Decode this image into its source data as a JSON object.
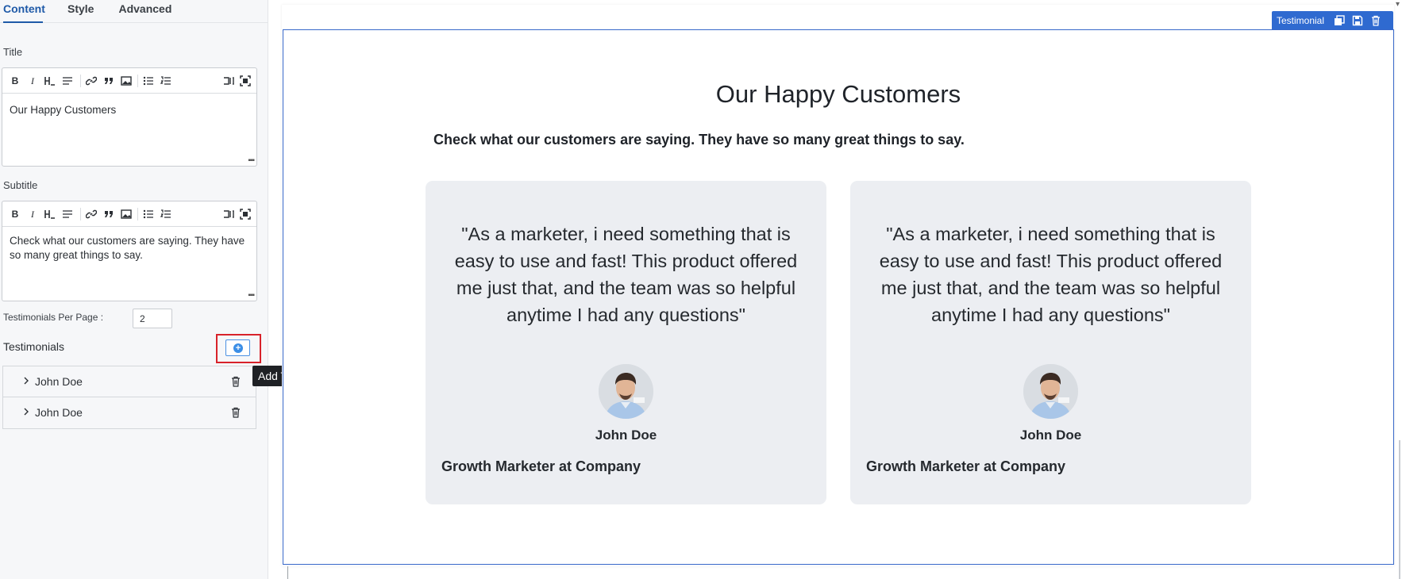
{
  "tabs": [
    {
      "label": "Content",
      "active": true
    },
    {
      "label": "Style",
      "active": false
    },
    {
      "label": "Advanced",
      "active": false
    }
  ],
  "title_field": {
    "label": "Title",
    "value": "Our Happy Customers"
  },
  "subtitle_field": {
    "label": "Subtitle",
    "value": "Check what our customers are saying. They have so many great things to say."
  },
  "editor_toolbar_icons": [
    "bold-icon",
    "italic-icon",
    "heading-icon",
    "strikethrough-icon",
    "link-icon",
    "quote-icon",
    "image-icon",
    "bullet-list-icon",
    "numbered-list-icon",
    "side-by-side-icon",
    "fullscreen-icon"
  ],
  "editor_toolbar_glyphs": {
    "bold": "B",
    "italic": "I"
  },
  "per_page": {
    "label": "Testimonials Per Page :",
    "value": "2"
  },
  "testimonials_section": {
    "label": "Testimonials",
    "add_tooltip": "Add Testimonial",
    "items": [
      {
        "name": "John Doe"
      },
      {
        "name": "John Doe"
      }
    ]
  },
  "widget_toolbar": {
    "name": "Testimonial",
    "icons": [
      "duplicate-icon",
      "save-icon",
      "delete-icon"
    ]
  },
  "preview": {
    "title": "Our Happy Customers",
    "subtitle": "Check what our customers are saying. They have so many great things to say.",
    "cards": [
      {
        "quote": "\"As a marketer, i need something that is easy to use and fast! This product offered me just that, and the team was so helpful anytime I had any questions\"",
        "name": "John Doe",
        "role": "Growth Marketer at Company"
      },
      {
        "quote": "\"As a marketer, i need something that is easy to use and fast! This product offered me just that, and the team was so helpful anytime I had any questions\"",
        "name": "John Doe",
        "role": "Growth Marketer at Company"
      }
    ]
  },
  "colors": {
    "accent": "#1f5aa8",
    "selection": "#2f6ad0",
    "highlight": "#d8222a",
    "card_bg": "#eceef2"
  }
}
